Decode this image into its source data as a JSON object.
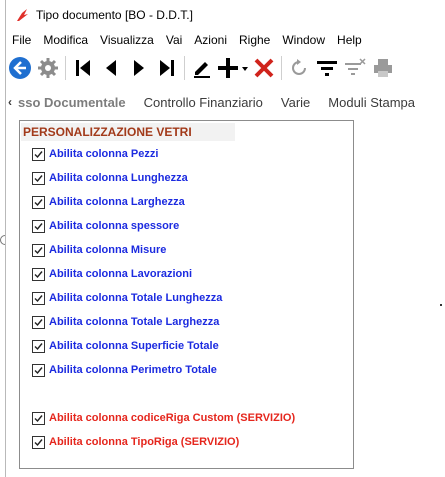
{
  "window": {
    "title": "Tipo documento [BO - D.D.T.]"
  },
  "menu": [
    "File",
    "Modifica",
    "Visualizza",
    "Vai",
    "Azioni",
    "Righe",
    "Window",
    "Help"
  ],
  "toolbar": {
    "icons": [
      "back-circle-icon",
      "gear-icon",
      "first-record-icon",
      "previous-record-icon",
      "next-record-icon",
      "last-record-icon",
      "edit-pencil-icon",
      "add-plus-icon",
      "delete-x-icon",
      "refresh-icon",
      "filter-icon",
      "clear-filter-icon",
      "print-icon"
    ]
  },
  "tabs": {
    "chevron": "‹",
    "items": [
      "sso Documentale",
      "Controllo Finanziario",
      "Varie",
      "Moduli Stampa"
    ]
  },
  "group": {
    "title": "PERSONALIZZAZIONE VETRI",
    "options": [
      {
        "label": "Abilita colonna Pezzi",
        "checked": true
      },
      {
        "label": "Abilita colonna Lunghezza",
        "checked": true
      },
      {
        "label": "Abilita colonna Larghezza",
        "checked": true
      },
      {
        "label": "Abilita colonna spessore",
        "checked": true
      },
      {
        "label": "Abilita colonna Misure",
        "checked": true
      },
      {
        "label": "Abilita colonna Lavorazioni",
        "checked": true
      },
      {
        "label": "Abilita colonna Totale Lunghezza",
        "checked": true
      },
      {
        "label": "Abilita colonna Totale Larghezza",
        "checked": true
      },
      {
        "label": "Abilita colonna Superficie Totale",
        "checked": true
      },
      {
        "label": "Abilita colonna Perimetro Totale",
        "checked": true
      }
    ],
    "service_options": [
      {
        "label": "Abilita colonna codiceRiga Custom (SERVIZIO)",
        "checked": true
      },
      {
        "label": "Abilita colonna TipoRiga (SERVIZIO)",
        "checked": true
      }
    ]
  },
  "colors": {
    "blue_label": "#1c2be0",
    "red_label": "#e5261d",
    "group_title": "#a23a1a",
    "accent_blue": "#1f6fd0"
  }
}
